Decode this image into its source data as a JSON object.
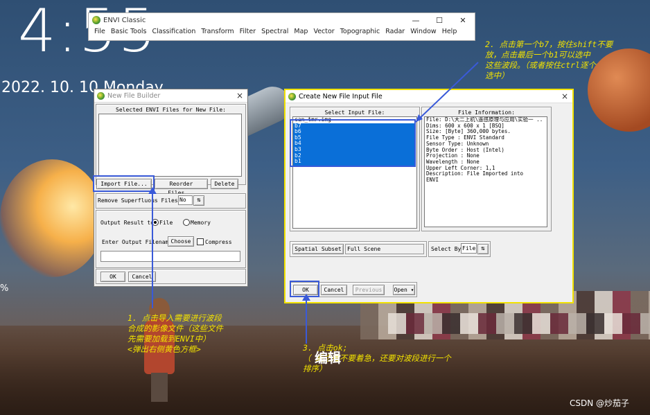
{
  "lockscreen": {
    "time": "4:55",
    "date": "2022. 10. 10  Monday",
    "percent": "%"
  },
  "envi_main": {
    "title": "ENVI Classic",
    "window_buttons": [
      "—",
      "☐",
      "✕"
    ],
    "menu": [
      "File",
      "Basic Tools",
      "Classification",
      "Transform",
      "Filter",
      "Spectral",
      "Map",
      "Vector",
      "Topographic",
      "Radar",
      "Window",
      "Help"
    ]
  },
  "new_file_builder": {
    "title": "New File Builder",
    "close": "×",
    "selected_files_label": "Selected ENVI Files for New File:",
    "import_button": "Import File...",
    "reorder_button": "Reorder Files...",
    "delete_button": "Delete",
    "remove_superfluous_label": "Remove Superfluous Files ?",
    "remove_superfluous_value": "No",
    "output_result_label": "Output Result to",
    "output_file_option": "File",
    "output_memory_option": "Memory",
    "enter_output_filename_label": "Enter Output Filename",
    "choose_button": "Choose",
    "compress_label": "Compress",
    "ok_button": "OK",
    "cancel_button": "Cancel"
  },
  "create_input_file": {
    "title": "Create New File Input File",
    "close": "×",
    "select_input_label": "Select Input File:",
    "files": [
      "can_tmr.img",
      "b7",
      "b6",
      "b5",
      "b4",
      "b3",
      "b2",
      "b1"
    ],
    "selected_files": [
      "b7",
      "b6",
      "b5",
      "b4",
      "b3",
      "b2",
      "b1"
    ],
    "file_info_label": "File Information:",
    "file_info": [
      "File: D:\\大二上机\\遥感原理与应用\\实验一  ..",
      "Dims: 600 x 600 x 1 [BSQ]",
      "Size: [Byte] 360,000 bytes.",
      "File Type  : ENVI Standard",
      "Sensor Type: Unknown",
      "Byte Order : Host (Intel)",
      "Projection : None",
      "Wavelength : None",
      "Upper Left Corner: 1,1",
      "Description: File Imported into",
      "ENVI"
    ],
    "spatial_subset_button": "Spatial Subset",
    "spatial_subset_value": "Full Scene",
    "select_by_label": "Select By",
    "select_by_value": "File",
    "ok_button": "OK",
    "cancel_button": "Cancel",
    "previous_button": "Previous",
    "open_button": "Open ▾"
  },
  "annotations": {
    "note1": [
      "1. 点击导入需要进行波段",
      "合成的影像文件（这些文件",
      "先需要加载到ENVI中）",
      "<弹出右侧黄色方框>"
    ],
    "note2": [
      "2. 点击第一个b7，按住shift不要",
      "放，点击最后一个b1可以选中",
      "这些波段。（或者按住ctrl逐个",
      "选中）"
    ],
    "note3": [
      "3. 点击ok;",
      "（        成之后不要着急，还要对波段进行一个",
      "排序）"
    ],
    "edit_label": "编辑",
    "watermark": "CSDN @炒茄子"
  },
  "colors": {
    "annotation": "#f2e200",
    "highlight": "#3a5ad8",
    "selection": "#0a6fd8"
  }
}
